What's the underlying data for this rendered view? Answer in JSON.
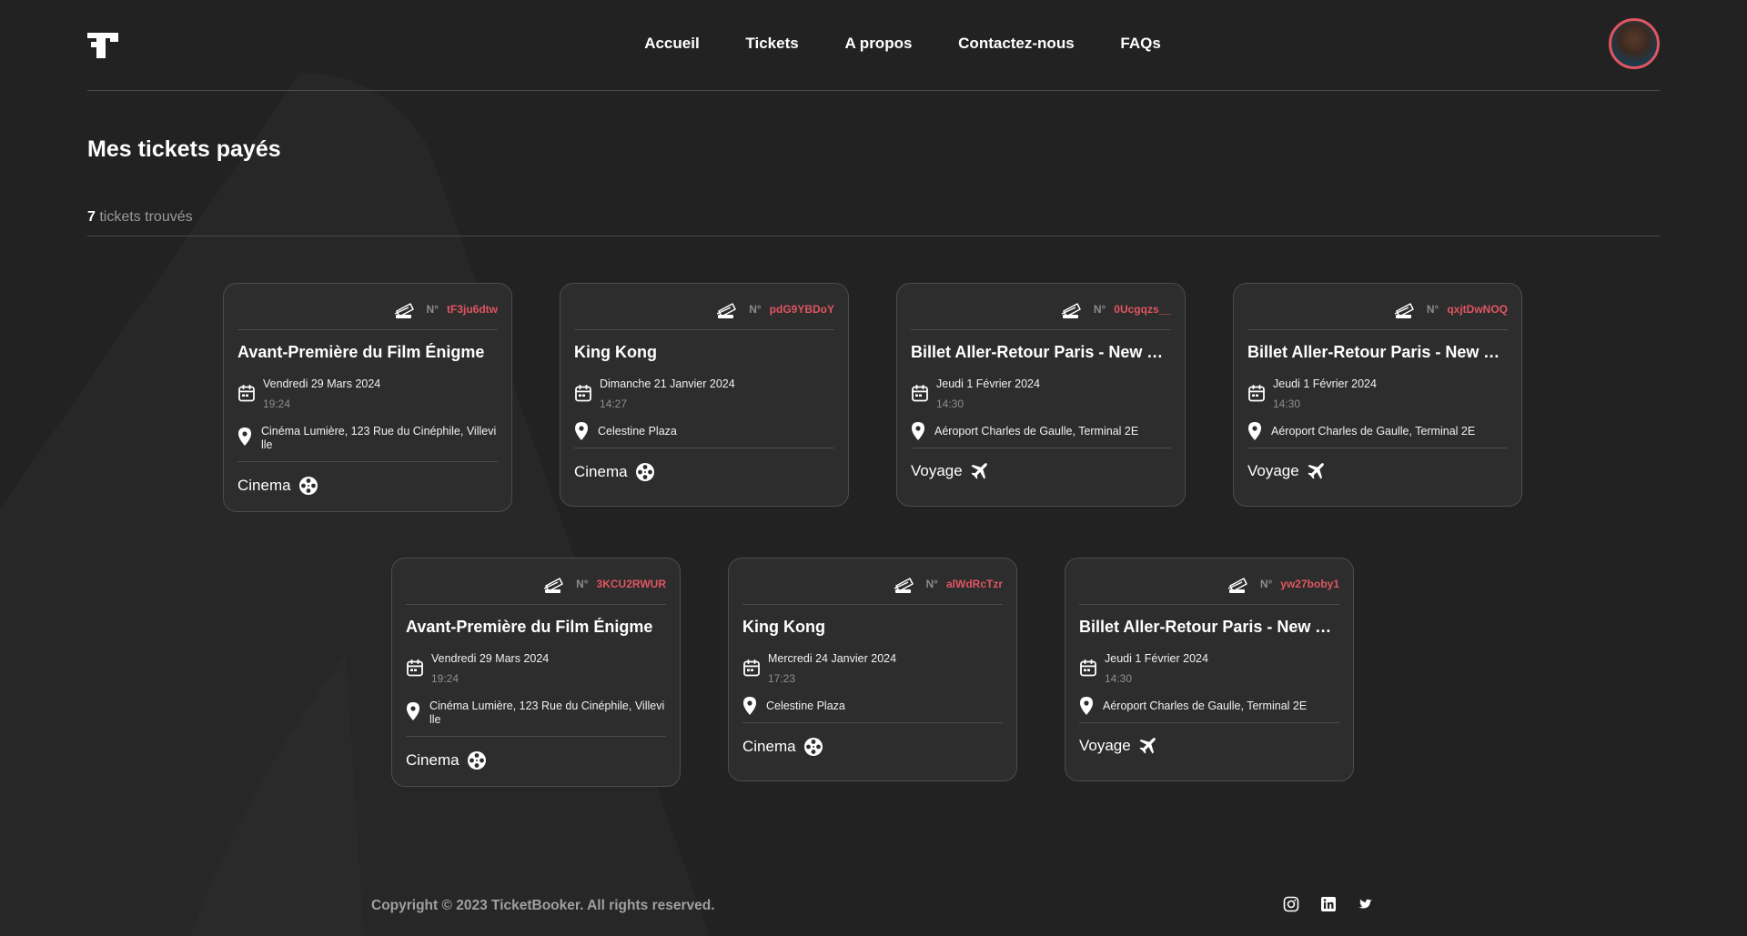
{
  "nav": {
    "items": [
      "Accueil",
      "Tickets",
      "A propos",
      "Contactez-nous",
      "FAQs"
    ]
  },
  "page": {
    "title": "Mes tickets payés",
    "count": "7",
    "count_suffix": "tickets trouvés"
  },
  "tickets": [
    {
      "no_label": "N°",
      "code": "tF3ju6dtw",
      "name": "Avant-Première du Film Énigme",
      "date": "Vendredi 29 Mars 2024",
      "time": "19:24",
      "address": "Cinéma Lumière, 123 Rue du Cinéphile, Villeville",
      "category": "Cinema",
      "category_icon": "film-reel-icon"
    },
    {
      "no_label": "N°",
      "code": "pdG9YBDoY",
      "name": "King Kong",
      "date": "Dimanche 21 Janvier 2024",
      "time": "14:27",
      "address": "Celestine Plaza",
      "category": "Cinema",
      "category_icon": "film-reel-icon"
    },
    {
      "no_label": "N°",
      "code": "0Ucgqzs__",
      "name": "Billet Aller-Retour Paris - New York",
      "date": "Jeudi 1 Février 2024",
      "time": "14:30",
      "address": "Aéroport Charles de Gaulle, Terminal 2E",
      "category": "Voyage",
      "category_icon": "airplane-icon"
    },
    {
      "no_label": "N°",
      "code": "qxjtDwNOQ",
      "name": "Billet Aller-Retour Paris - New York",
      "date": "Jeudi 1 Février 2024",
      "time": "14:30",
      "address": "Aéroport Charles de Gaulle, Terminal 2E",
      "category": "Voyage",
      "category_icon": "airplane-icon"
    },
    {
      "no_label": "N°",
      "code": "3KCU2RWUR",
      "name": "Avant-Première du Film Énigme",
      "date": "Vendredi 29 Mars 2024",
      "time": "19:24",
      "address": "Cinéma Lumière, 123 Rue du Cinéphile, Villeville",
      "category": "Cinema",
      "category_icon": "film-reel-icon"
    },
    {
      "no_label": "N°",
      "code": "alWdRcTzr",
      "name": "King Kong",
      "date": "Mercredi 24 Janvier 2024",
      "time": "17:23",
      "address": "Celestine Plaza",
      "category": "Cinema",
      "category_icon": "film-reel-icon"
    },
    {
      "no_label": "N°",
      "code": "yw27boby1",
      "name": "Billet Aller-Retour Paris - New York",
      "date": "Jeudi 1 Février 2024",
      "time": "14:30",
      "address": "Aéroport Charles de Gaulle, Terminal 2E",
      "category": "Voyage",
      "category_icon": "airplane-icon"
    }
  ],
  "footer": {
    "copyright": "Copyright © 2023 TicketBooker. All rights reserved.",
    "social": [
      "instagram-icon",
      "linkedin-icon",
      "twitter-icon"
    ]
  },
  "colors": {
    "background": "#222222",
    "card": "#2d2d2d",
    "accent": "#e05561",
    "muted": "#8c8c8c"
  }
}
